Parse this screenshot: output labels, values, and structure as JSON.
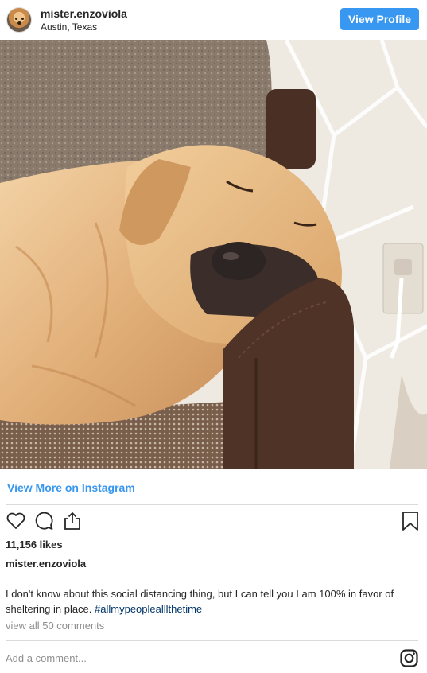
{
  "header": {
    "username": "mister.enzoviola",
    "location": "Austin, Texas",
    "view_profile_label": "View Profile"
  },
  "post": {
    "view_more_label": "View More on Instagram",
    "likes": "11,156 likes",
    "caption_username": "mister.enzoviola",
    "caption_text": "I don't know about this social distancing thing, but I can tell you I am 100% in favor of sheltering in place.",
    "caption_hashtag": "#allmypeoplealllthetime",
    "view_comments": "view all 50 comments",
    "add_comment_placeholder": "Add a comment..."
  },
  "colors": {
    "accent": "#3897f0",
    "hashtag": "#003569",
    "muted": "#8e8e8e",
    "divider": "#dbdbdb"
  },
  "icons": [
    "heart-icon",
    "comment-icon",
    "share-icon",
    "bookmark-icon",
    "instagram-icon"
  ]
}
